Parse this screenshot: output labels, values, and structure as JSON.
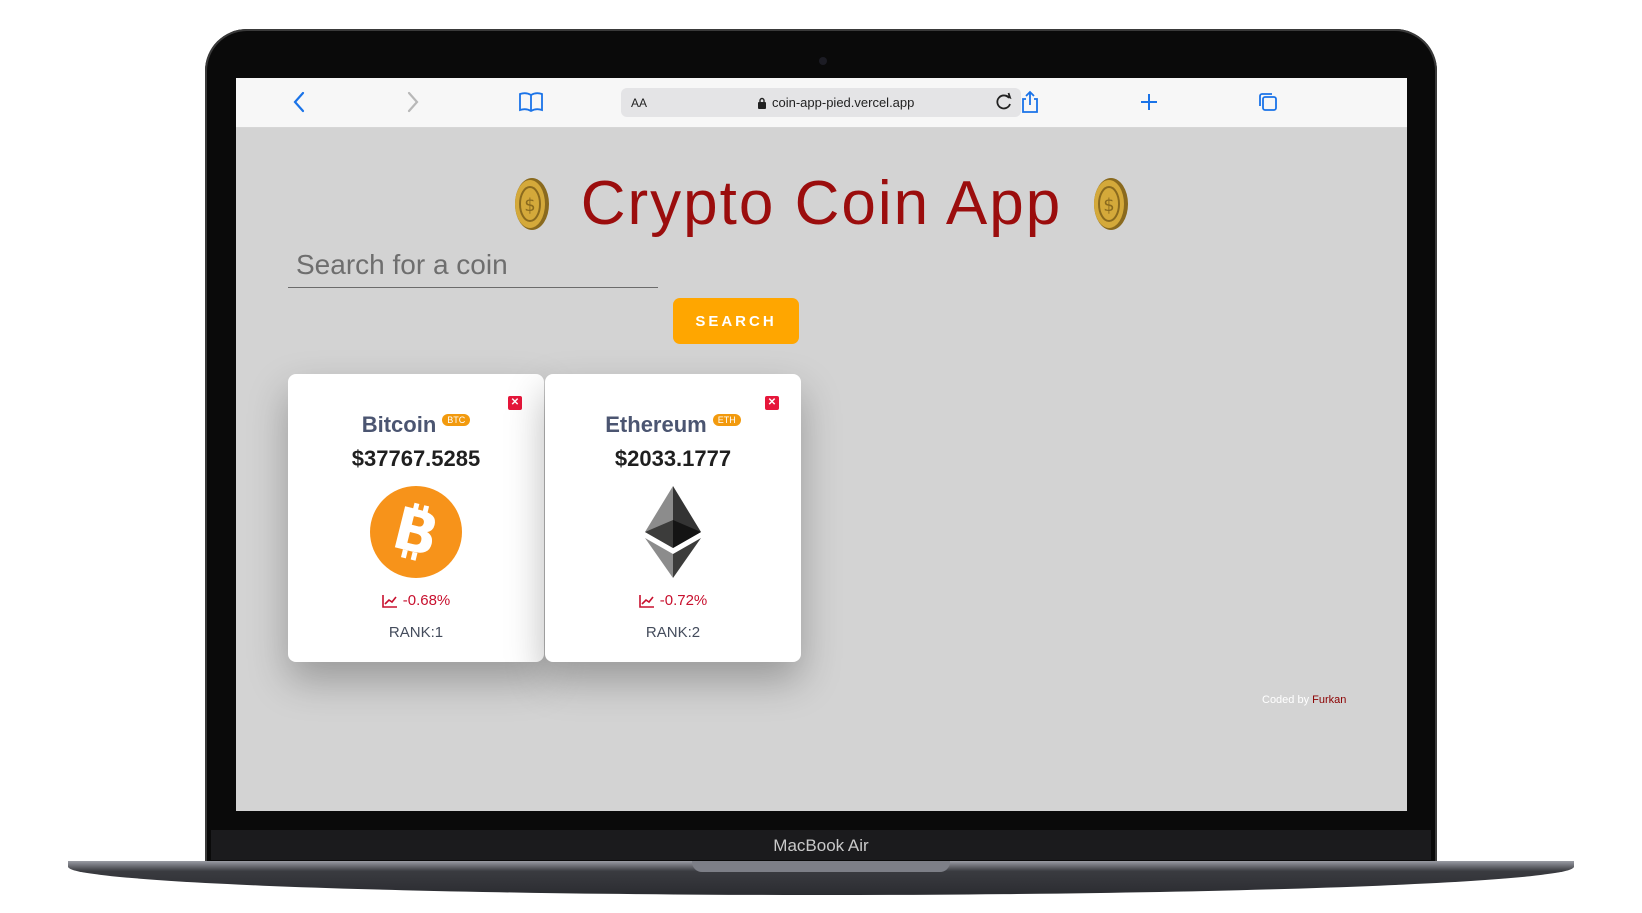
{
  "device": {
    "label": "MacBook Air"
  },
  "browser": {
    "url_aa": "AA",
    "url": "coin-app-pied.vercel.app"
  },
  "app": {
    "title": "Crypto Coin App",
    "search": {
      "placeholder": "Search for a coin",
      "button_label": "SEARCH"
    }
  },
  "coins": [
    {
      "name": "Bitcoin",
      "symbol": "BTC",
      "price": "$37767.5285",
      "change": "-0.68%",
      "rank": "RANK:1",
      "logo_color": "#f7931a"
    },
    {
      "name": "Ethereum",
      "symbol": "ETH",
      "price": "$2033.1777",
      "change": "-0.72%",
      "rank": "RANK:2",
      "logo_color": "#343434"
    }
  ],
  "footer": {
    "prefix": "Coded by ",
    "author": "Furkan"
  },
  "colors": {
    "accent": "#ffa600",
    "title": "#9b0d0d",
    "negative": "#c8102e",
    "close": "#e6163a"
  }
}
